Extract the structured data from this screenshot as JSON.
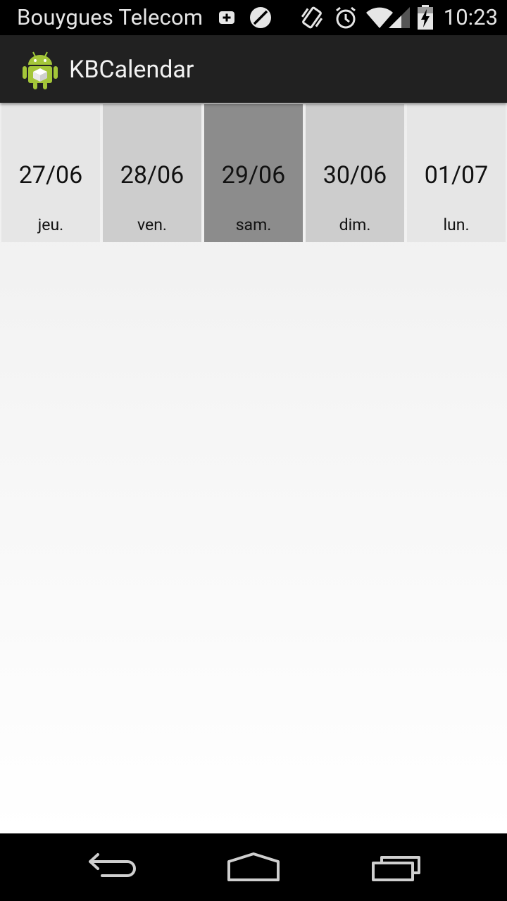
{
  "status_bar": {
    "carrier": "Bouygues Telecom",
    "time": "10:23",
    "icons": [
      "add-notification-icon",
      "sync-off-icon",
      "vibrate-icon",
      "alarm-icon",
      "wifi-icon",
      "signal-icon",
      "battery-charging-icon"
    ]
  },
  "action_bar": {
    "app_icon": "android-robot-icon",
    "title": "KBCalendar"
  },
  "days": [
    {
      "date": "27/06",
      "weekday": "jeu.",
      "color": "#e6e6e6"
    },
    {
      "date": "28/06",
      "weekday": "ven.",
      "color": "#cdcdcd"
    },
    {
      "date": "29/06",
      "weekday": "sam.",
      "color": "#8c8c8c",
      "selected": true
    },
    {
      "date": "30/06",
      "weekday": "dim.",
      "color": "#cdcdcd"
    },
    {
      "date": "01/07",
      "weekday": "lun.",
      "color": "#e6e6e6"
    }
  ],
  "nav_bar": {
    "icons": [
      "back-icon",
      "home-icon",
      "recent-apps-icon"
    ]
  }
}
